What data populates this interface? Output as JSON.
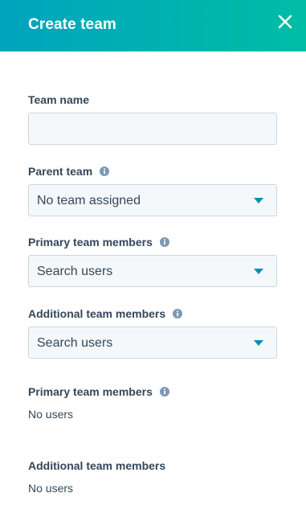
{
  "header": {
    "title": "Create team",
    "close_icon": "close-icon"
  },
  "colors": {
    "header_gradient_start": "#00a4bd",
    "header_gradient_end": "#00bda5",
    "text": "#33475b",
    "input_background": "#f5f8fa",
    "input_border": "#cbd6e2",
    "caret": "#0091ae",
    "info_icon": "#7c98b6"
  },
  "form": {
    "team_name": {
      "label": "Team name",
      "value": ""
    },
    "parent_team": {
      "label": "Parent team",
      "selected": "No team assigned"
    },
    "primary_members": {
      "label": "Primary team members",
      "placeholder": "Search users"
    },
    "additional_members": {
      "label": "Additional team members",
      "placeholder": "Search users"
    }
  },
  "summary": {
    "primary": {
      "label": "Primary team members",
      "value": "No users"
    },
    "additional": {
      "label": "Additional team members",
      "value": "No users"
    }
  }
}
